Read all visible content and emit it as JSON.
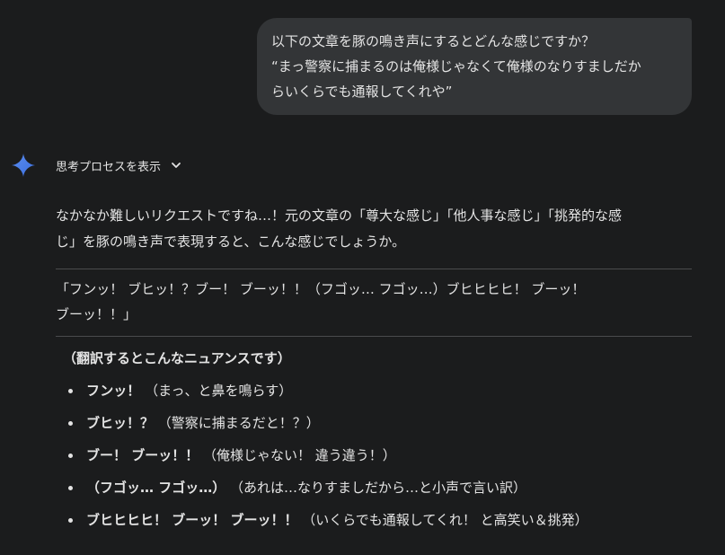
{
  "user_message": {
    "lines": [
      "以下の文章を豚の鳴き声にするとどんな感じですか？",
      "“まっ警察に捕まるのは俺様じゃなくて俺様のなりすましだか",
      "らいくらでも通報してくれや”"
    ]
  },
  "assistant": {
    "icon": "gemini-sparkle-icon",
    "thinking_label": "思考プロセスを表示",
    "intro": [
      "なかなか難しいリクエストですね…！元の文章の「尊大な感じ」「他人事な感じ」「挑発的な感",
      "じ」を豚の鳴き声で表現すると、こんな感じでしょうか。"
    ],
    "pig_quote": [
      "「フンッ！ ブヒッ！？ブー！ ブーッ！！（フゴッ… フゴッ…）ブヒヒヒヒ！ ブーッ！",
      "ブーッ！！」"
    ],
    "translation_title": "（翻訳するとこんなニュアンスです）",
    "items": [
      {
        "sound": "フンッ！",
        "meaning": "（まっ、と鼻を鳴らす）"
      },
      {
        "sound": "ブヒッ！？",
        "meaning": "（警察に捕まるだと！？）"
      },
      {
        "sound": "ブー！ ブーッ！！",
        "meaning": "（俺様じゃない！ 違う違う！）"
      },
      {
        "sound": "（フゴッ… フゴッ…）",
        "meaning": "（あれは…なりすましだから…と小声で言い訳）"
      },
      {
        "sound": "ブヒヒヒヒ！ ブーッ！ ブーッ！！",
        "meaning": "（いくらでも通報してくれ！ と高笑い＆挑発）"
      }
    ]
  },
  "colors": {
    "background": "#1b1c1d",
    "bubble": "#333537",
    "text": "#e3e3e3",
    "accent": "#4285f4"
  }
}
